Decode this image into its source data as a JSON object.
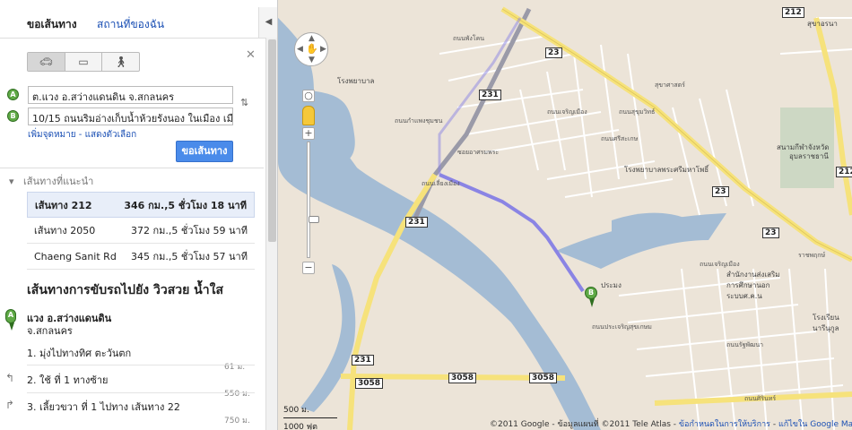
{
  "tabs": {
    "directions": "ขอเส้นทาง",
    "my_places": "สถานที่ของฉัน"
  },
  "inputs": {
    "from_marker": "A",
    "from_value": "ต.แวง อ.สว่างแดนดิน จ.สกลนคร",
    "to_marker": "B",
    "to_value": "10/15 ถนนริมอ่างเก็บน้ำห้วยรังนอง ในเมือง เมือง สกลนคร"
  },
  "add_destination": "เพิ่มจุดหมาย - แสดงตัวเลือก",
  "get_directions_button": "ขอเส้นทาง",
  "suggested_heading": "เส้นทางที่แนะนำ",
  "routes": [
    {
      "name": "เส้นทาง 212",
      "detail": "346 กม.,5 ชั่วโมง 18 นาที"
    },
    {
      "name": "เส้นทาง 2050",
      "detail": "372 กม.,5 ชั่วโมง 59 นาที"
    },
    {
      "name": "Chaeng Sanit Rd",
      "detail": "345 กม.,5 ชั่วโมง 57 นาที"
    }
  ],
  "directions_title": "เส้นทางการขับรถไปยัง วิวสวย น้ำใส",
  "start": {
    "marker": "A",
    "name": "แวง อ.สว่างแดนดิน",
    "province": "จ.สกลนคร"
  },
  "steps": [
    {
      "text": "1. มุ่งไปทางทิศ ตะวันตก",
      "dist": "61 ม."
    },
    {
      "text": "2. ใช้ ที่ 1 ทางซ้าย",
      "dist": "550 ม."
    },
    {
      "text": "3. เลี้ยวขวา ที่ 1 ไปทาง เส้นทาง 22",
      "dist": "750 ม."
    }
  ],
  "map": {
    "road_badges": [
      "212",
      "23",
      "231",
      "23",
      "231",
      "23",
      "212",
      "231",
      "3058",
      "3058",
      "3058"
    ],
    "streets": [
      "ถนนพังโคน",
      "ถนนกำแพงชุมชน",
      "ถนนเลี่ยงเมือง",
      "ถนนเจริญเมือง",
      "ถนนศรีสะเกษ",
      "ซอยอาศรมพระ",
      "ราชพฤกษ์",
      "สุขาศาสตร์",
      "ถนนเจริญเมือง",
      "ถนนประเจริญสุขเกษม",
      "ถนนสุขุมวิทธ์",
      "ถนนรัฐพัฒนา",
      "ถนนศิรินทร์"
    ],
    "places": [
      "โรงพยาบาล",
      "สนามกีฬาจังหวัด",
      "อุบลราชธานี",
      "โรงพยาบาลพระศรีมหาโพธิ์",
      "สำนักงานส่งเสริม",
      "การศึกษานอก",
      "ระบบศ.ค.น",
      "ประมง",
      "โรงเรียน",
      "นารีนุกูล",
      "สุขาอรนา"
    ],
    "dest_marker": "B",
    "scale_m": "500 ม.",
    "scale_ft": "1000 ฟุต",
    "copyright": "©2011 Google - ข้อมูลแผนที่ ©2011 Tele Atlas -",
    "terms_link": "ข้อกำหนดในการให้บริการ",
    "report_link": "แก้ไขใน Google Map Maker",
    "colors": {
      "water": "#a4bcd4",
      "land": "#ece4d8",
      "main_road": "#f6e27b",
      "route": "#8a84e4",
      "park": "#cdd8c4"
    }
  }
}
